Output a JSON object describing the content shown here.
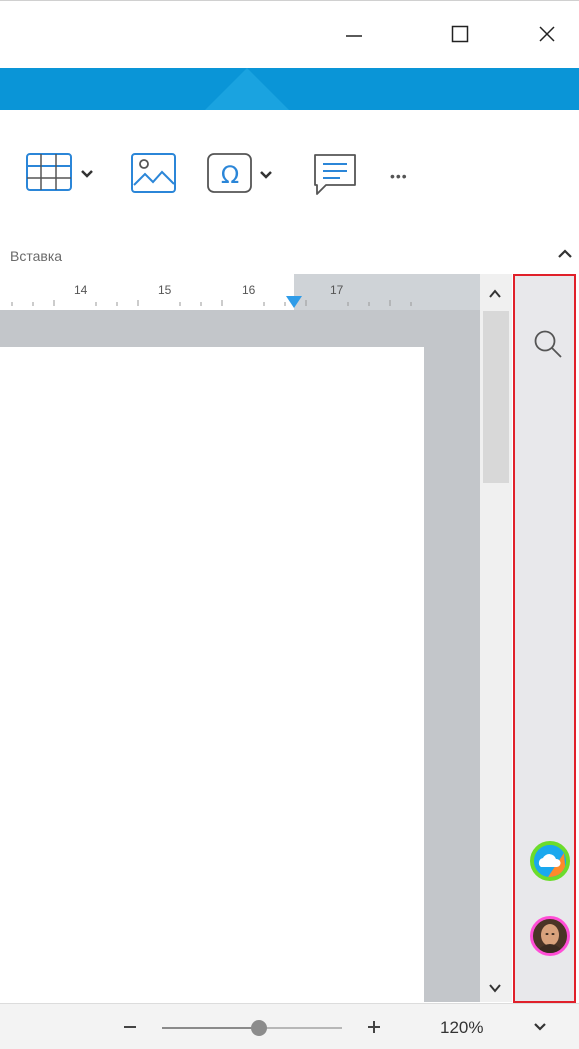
{
  "window": {
    "minimize_icon": "minimize-icon",
    "maximize_icon": "maximize-icon",
    "close_icon": "close-icon"
  },
  "ribbon": {
    "group_label": "Вставка",
    "items": [
      {
        "name": "table",
        "icon": "table-icon",
        "has_dropdown": true
      },
      {
        "name": "image",
        "icon": "image-icon",
        "has_dropdown": false
      },
      {
        "name": "symbol",
        "icon": "omega-icon",
        "has_dropdown": true
      },
      {
        "name": "comment",
        "icon": "comment-icon",
        "has_dropdown": false
      },
      {
        "name": "more",
        "icon": "more-icon",
        "has_dropdown": false
      }
    ],
    "more_label": "•••",
    "collapse_icon": "chevron-up-icon"
  },
  "ruler": {
    "labels": [
      "14",
      "15",
      "16",
      "17"
    ]
  },
  "side_panel": {
    "search_icon": "search-icon",
    "border_color": "#e0202a",
    "avatars": [
      {
        "name": "cloud-avatar",
        "ring_color": "#6cdc2b"
      },
      {
        "name": "user-avatar",
        "ring_color": "#ff4dd6"
      }
    ]
  },
  "statusbar": {
    "zoom_minus": "−",
    "zoom_plus": "+",
    "zoom_level": "120%",
    "zoom_fraction": 0.55
  },
  "colors": {
    "accent": "#0a95d7",
    "indent_marker": "#2f9ce8"
  }
}
